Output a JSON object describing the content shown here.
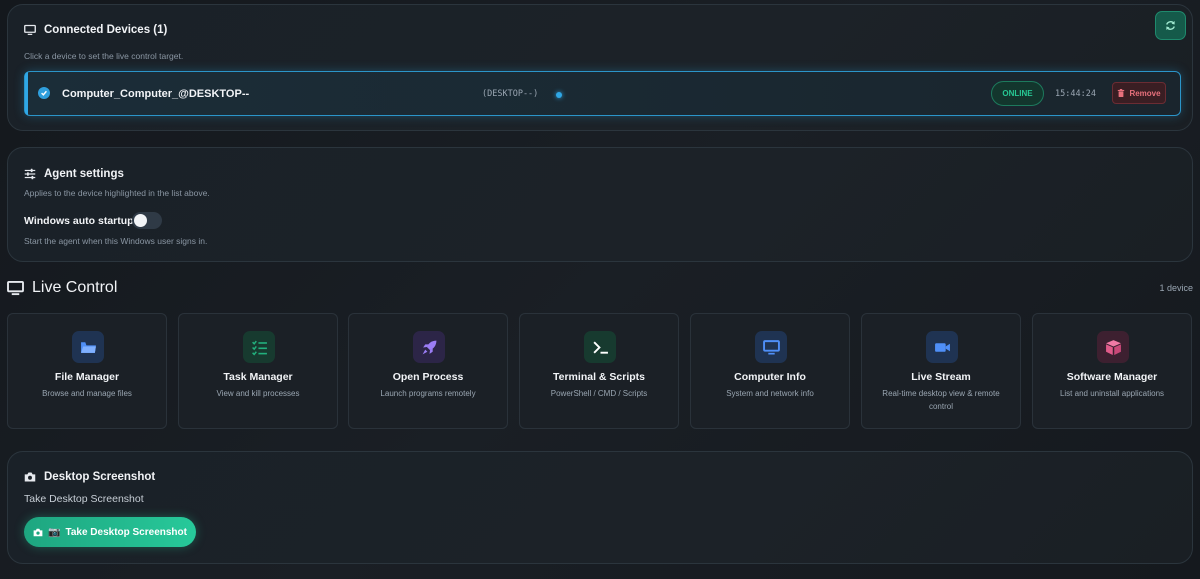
{
  "connected_devices": {
    "title": "Connected Devices (1)",
    "subtitle": "Click a device to set the live control target.",
    "refresh_icon": "refresh-icon",
    "device": {
      "name": "Computer_Computer_@DESKTOP--",
      "host": "(DESKTOP--)",
      "status": "ONLINE",
      "time": "15:44:24",
      "remove_label": "Remove"
    }
  },
  "agent_settings": {
    "title": "Agent settings",
    "subtitle": "Applies to the device highlighted in the list above.",
    "toggle_label": "Windows auto startup",
    "toggle_state": "off",
    "toggle_help": "Start the agent when this Windows user signs in."
  },
  "live_control": {
    "title": "Live Control",
    "count": "1 device",
    "tiles": [
      {
        "title": "File Manager",
        "desc": "Browse and manage files",
        "icon": "folder-icon",
        "color": "#4f8ff7"
      },
      {
        "title": "Task Manager",
        "desc": "View and kill processes",
        "icon": "tasklist-icon",
        "color": "#22b07d"
      },
      {
        "title": "Open Process",
        "desc": "Launch programs remotely",
        "icon": "rocket-icon",
        "color": "#9b7df5"
      },
      {
        "title": "Terminal & Scripts",
        "desc": "PowerShell / CMD / Scripts",
        "icon": "terminal-icon",
        "color": "#22b07d"
      },
      {
        "title": "Computer Info",
        "desc": "System and network info",
        "icon": "monitor-icon",
        "color": "#4f8ff7"
      },
      {
        "title": "Live Stream",
        "desc": "Real-time desktop view & remote control",
        "icon": "video-icon",
        "color": "#4f8ff7"
      },
      {
        "title": "Software Manager",
        "desc": "List and uninstall applications",
        "icon": "package-icon",
        "color": "#e05b8a"
      }
    ]
  },
  "desktop_screenshot": {
    "title": "Desktop Screenshot",
    "text": "Take Desktop Screenshot",
    "button_label": "Take Desktop Screenshot",
    "button_emoji": "📷"
  }
}
